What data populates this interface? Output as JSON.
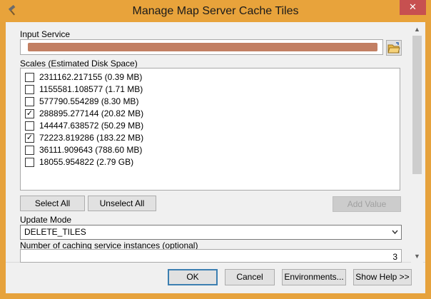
{
  "window": {
    "title": "Manage Map Server Cache Tiles",
    "close_label": "✕",
    "accent_color": "#e8a33b"
  },
  "form": {
    "input_service_label": "Input Service",
    "input_service_value": "",
    "scales_label": "Scales (Estimated Disk Space)",
    "scales": [
      {
        "label": "2311162.217155 (0.39 MB)",
        "checked": false
      },
      {
        "label": "1155581.108577 (1.71 MB)",
        "checked": false
      },
      {
        "label": "577790.554289 (8.30 MB)",
        "checked": false
      },
      {
        "label": "288895.277144 (20.82 MB)",
        "checked": true
      },
      {
        "label": "144447.638572 (50.29 MB)",
        "checked": false
      },
      {
        "label": "72223.819286 (183.22 MB)",
        "checked": true
      },
      {
        "label": "36111.909643 (788.60 MB)",
        "checked": false
      },
      {
        "label": "18055.954822 (2.79 GB)",
        "checked": false
      }
    ],
    "select_all_label": "Select All",
    "unselect_all_label": "Unselect All",
    "add_value_label": "Add Value",
    "update_mode_label": "Update Mode",
    "update_mode_value": "DELETE_TILES",
    "instances_label": "Number of caching service instances (optional)",
    "instances_value": "3"
  },
  "footer": {
    "ok_label": "OK",
    "cancel_label": "Cancel",
    "environments_label": "Environments...",
    "show_help_label": "Show Help >>"
  },
  "icons": {
    "app": "hammer-icon",
    "folder": "folder-open-icon",
    "dropdown": "chevron-down-icon",
    "check": "✓"
  }
}
